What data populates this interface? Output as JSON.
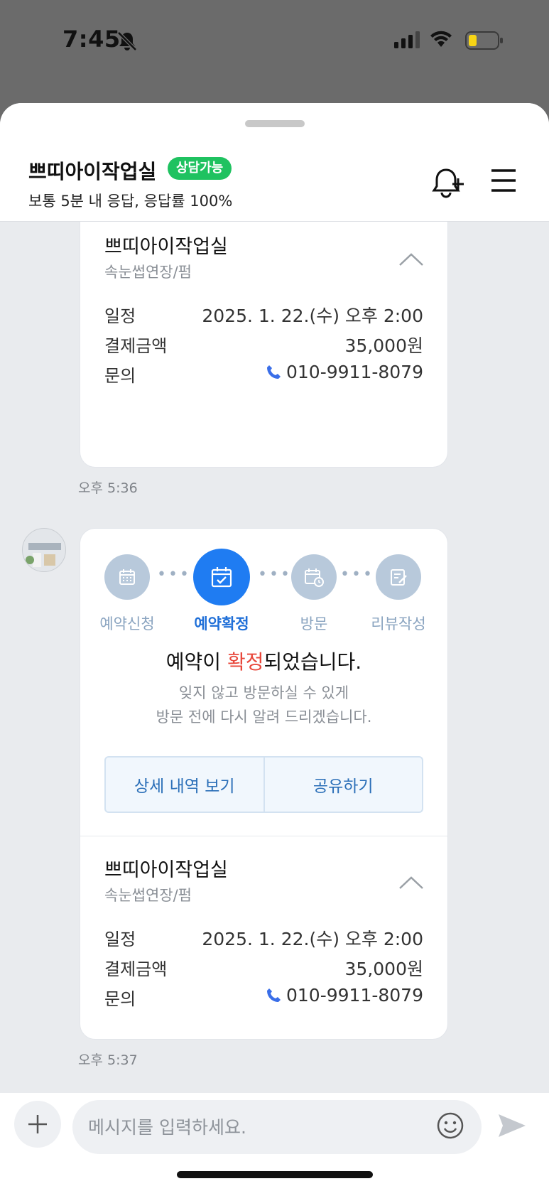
{
  "status_bar": {
    "time": "7:45"
  },
  "header": {
    "shop_name": "쁘띠아이작업실",
    "badge": "상담가능",
    "subtitle": "보통 5분 내 응답, 응답률 100%"
  },
  "messages": [
    {
      "store_name": "쁘띠아이작업실",
      "service": "속눈썹연장/펌",
      "rows": [
        {
          "label": "일정",
          "value": "2025. 1. 22.(수) 오후 2:00"
        },
        {
          "label": "결제금액",
          "value": "35,000원"
        },
        {
          "label": "문의",
          "value": "010-9911-8079"
        }
      ],
      "time": "오후 5:36"
    },
    {
      "steps": [
        {
          "label": "예약신청",
          "icon": "calendar-icon"
        },
        {
          "label": "예약확정",
          "icon": "calendar-check-icon"
        },
        {
          "label": "방문",
          "icon": "calendar-clock-icon"
        },
        {
          "label": "리뷰작성",
          "icon": "review-edit-icon"
        }
      ],
      "title_before": "예약이 ",
      "title_highlight": "확정",
      "title_after": "되었습니다.",
      "text_line1": "잊지 않고 방문하실 수 있게",
      "text_line2": "방문 전에 다시 알려 드리겠습니다.",
      "btn_details": "상세 내역 보기",
      "btn_share": "공유하기",
      "store_name": "쁘띠아이작업실",
      "service": "속눈썹연장/펌",
      "rows": [
        {
          "label": "일정",
          "value": "2025. 1. 22.(수) 오후 2:00"
        },
        {
          "label": "결제금액",
          "value": "35,000원"
        },
        {
          "label": "문의",
          "value": "010-9911-8079"
        }
      ],
      "time": "오후 5:37"
    }
  ],
  "input": {
    "placeholder": "메시지를 입력하세요."
  },
  "colors": {
    "accent": "#1f7cf2",
    "badge": "#1fc260",
    "highlight": "#e8463a"
  }
}
